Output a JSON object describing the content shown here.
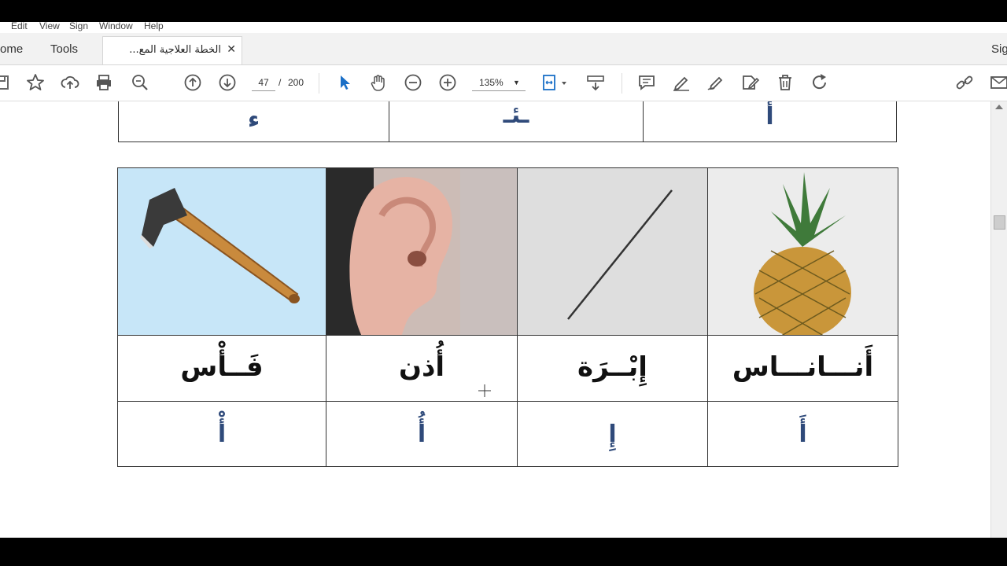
{
  "menu": {
    "items": [
      "Edit",
      "View",
      "Sign",
      "Window",
      "Help"
    ]
  },
  "tabs": {
    "home": "ome",
    "tools": "Tools",
    "document": "الخطة العلاجية المع...",
    "sign": "Sig"
  },
  "toolbar": {
    "current_page": "47",
    "page_separator": "/",
    "total_pages": "200",
    "zoom": "135%",
    "zoom_caret": "▼"
  },
  "document": {
    "top_row": {
      "cells": [
        "ء",
        "ـئـ",
        "أ"
      ]
    },
    "table": {
      "columns": [
        {
          "picture": "axe",
          "word": "فَــأْس",
          "letter": "أْ"
        },
        {
          "picture": "ear",
          "word": "أُذن",
          "letter": "أُ"
        },
        {
          "picture": "needle",
          "word": "إِبْــرَة",
          "letter": "إِ"
        },
        {
          "picture": "pineapple",
          "word": "أَنـــانـــاس",
          "letter": "أَ"
        }
      ]
    }
  },
  "colors": {
    "accent_blue": "#1a6fc7",
    "letter_blue": "#2f4a7a",
    "axe_bg": "#c7e6f8"
  }
}
